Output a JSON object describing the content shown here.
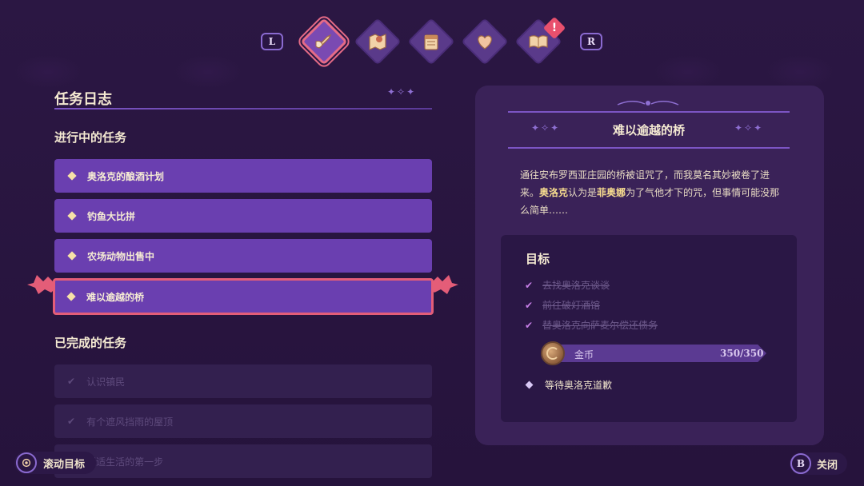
{
  "nav": {
    "left_bumper": "L",
    "right_bumper": "R",
    "tabs": [
      {
        "icon": "quill-scroll-icon",
        "active": true
      },
      {
        "icon": "map-pin-icon",
        "active": false
      },
      {
        "icon": "calendar-icon",
        "active": false
      },
      {
        "icon": "heart-icon",
        "active": false
      },
      {
        "icon": "open-book-icon",
        "active": false,
        "alert": "!"
      }
    ],
    "alert_mark": "!"
  },
  "journal": {
    "title": "任务日志",
    "in_progress_heading": "进行中的任务",
    "in_progress": [
      {
        "label": "奥洛克的酿酒计划",
        "selected": false
      },
      {
        "label": "钓鱼大比拼",
        "selected": false
      },
      {
        "label": "农场动物出售中",
        "selected": false
      },
      {
        "label": "难以逾越的桥",
        "selected": true
      }
    ],
    "completed_heading": "已完成的任务",
    "completed": [
      {
        "label": "认识镇民"
      },
      {
        "label": "有个遮风挡雨的屋顶"
      },
      {
        "label": "舒适生活的第一步"
      }
    ]
  },
  "detail": {
    "title": "难以逾越的桥",
    "desc_part1": "通往安布罗西亚庄园的桥被诅咒了，而我莫名其妙被卷了进来。",
    "desc_hl1": "奥洛克",
    "desc_part2": "认为是",
    "desc_hl2": "菲奥娜",
    "desc_part3": "为了气他才下的咒，但事情可能没那么简单……",
    "objectives_title": "目标",
    "objectives_done": [
      "去找奥洛克谈谈",
      "前往破灯酒馆",
      "替奥洛克向萨麦尔偿还债务"
    ],
    "coin": {
      "label": "金币",
      "value": "350/350",
      "progress": 1.0
    },
    "objective_pending": "等待奥洛克道歉"
  },
  "hints": {
    "scroll_label": "滚动目标",
    "close_button": "B",
    "close_label": "关闭"
  },
  "colors": {
    "background": "#281540",
    "quest_row": "#6a3fb0",
    "selected_border": "#e45d78",
    "highlight_text": "#f7dc8f",
    "panel": "#3a2258"
  }
}
